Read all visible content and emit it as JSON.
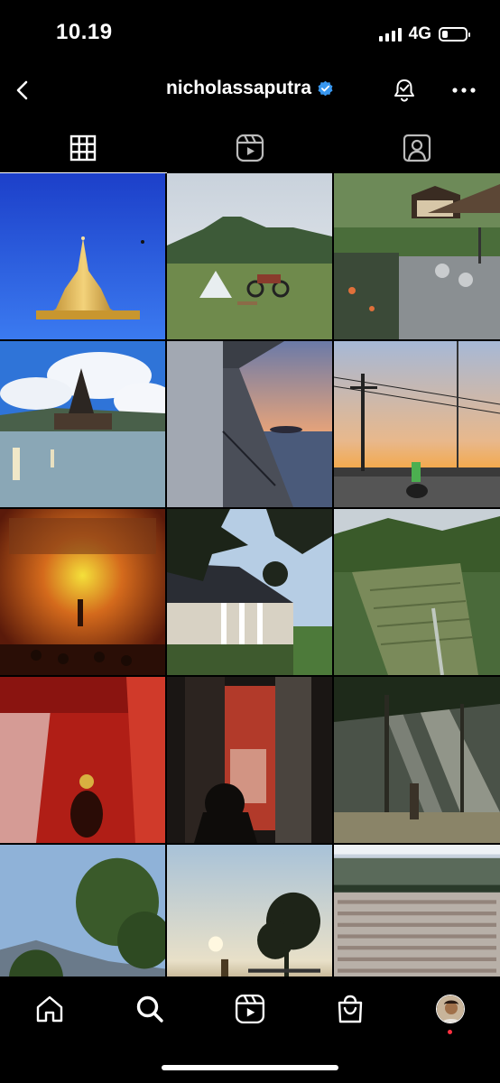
{
  "status_bar": {
    "time": "10.19",
    "network": "4G",
    "battery_level": 0.25
  },
  "header": {
    "username": "nicholassaputra",
    "verified": true,
    "accent_color": "#3897f0"
  },
  "tabs": [
    {
      "name": "posts-grid",
      "icon": "grid-icon",
      "active": true
    },
    {
      "name": "reels",
      "icon": "reels-icon",
      "active": false
    },
    {
      "name": "tagged",
      "icon": "tagged-person-icon",
      "active": false
    }
  ],
  "grid_posts": [
    {
      "subject": "golden-pagoda-blue-sky"
    },
    {
      "subject": "tent-motorbike-mountain"
    },
    {
      "subject": "villa-pond-deck"
    },
    {
      "subject": "lake-temple-clouds"
    },
    {
      "subject": "boat-deck-sunset"
    },
    {
      "subject": "power-pole-sunset-rider"
    },
    {
      "subject": "stage-performance-orange-light"
    },
    {
      "subject": "pavilion-leaves-silhouette"
    },
    {
      "subject": "rice-terraces-valley"
    },
    {
      "subject": "red-curtain-dancer"
    },
    {
      "subject": "doorway-red-shrine"
    },
    {
      "subject": "forest-sunbeams-figure"
    },
    {
      "subject": "tree-mountain-sky"
    },
    {
      "subject": "sunrise-field-fence"
    },
    {
      "subject": "stadium-crowd"
    }
  ],
  "bottom_nav": [
    {
      "name": "home",
      "icon": "home-icon"
    },
    {
      "name": "search",
      "icon": "search-icon"
    },
    {
      "name": "reels",
      "icon": "reels-icon"
    },
    {
      "name": "shop",
      "icon": "shopping-bag-icon"
    },
    {
      "name": "profile",
      "icon": "profile-avatar",
      "notification_dot": true
    }
  ]
}
